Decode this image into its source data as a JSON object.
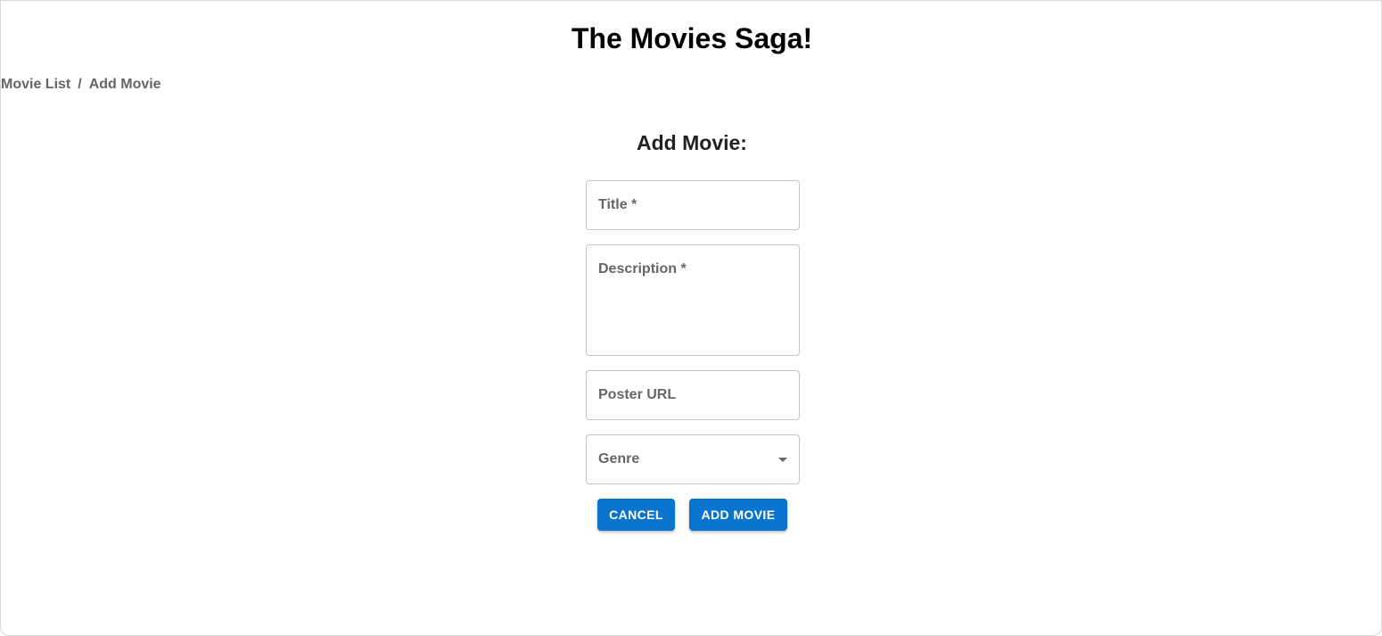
{
  "header": {
    "title": "The Movies Saga!"
  },
  "breadcrumb": {
    "items": [
      {
        "label": "Movie List"
      },
      {
        "label": "Add Movie"
      }
    ],
    "separator": "/"
  },
  "form": {
    "heading": "Add Movie:",
    "fields": {
      "title": {
        "label": "Title *",
        "value": ""
      },
      "description": {
        "label": "Description *",
        "value": ""
      },
      "poster_url": {
        "label": "Poster URL",
        "value": ""
      },
      "genre": {
        "label": "Genre",
        "selected": "",
        "icon": "chevron-down-icon"
      }
    },
    "buttons": {
      "cancel": "CANCEL",
      "submit": "ADD MOVIE"
    }
  },
  "colors": {
    "primary_button": "#0a74cf",
    "label_gray": "#666666",
    "border_gray": "#c4c4c4"
  }
}
